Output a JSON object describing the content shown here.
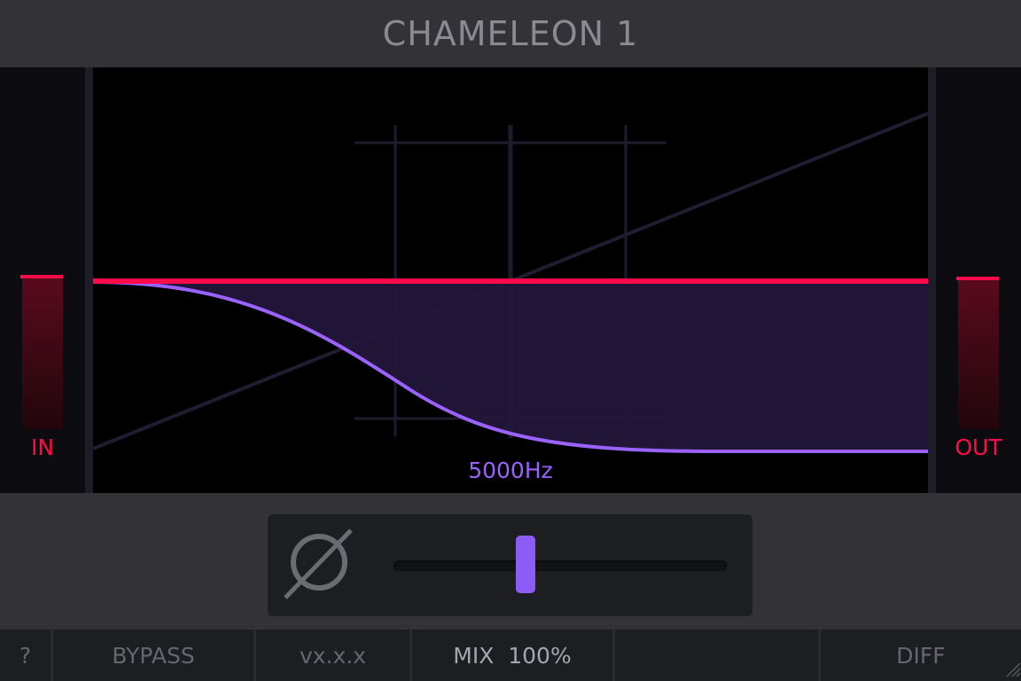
{
  "header": {
    "title": "CHAMELEON 1"
  },
  "meters": {
    "input": {
      "label": "IN",
      "level": 0.62
    },
    "output": {
      "label": "OUT",
      "level": 0.62
    }
  },
  "graph": {
    "frequency_readout": "5000Hz",
    "colors": {
      "flat_curve": "#ff0a4a",
      "filter_curve": "#9a62ff",
      "fill": "#23163d"
    }
  },
  "controls": {
    "phase_icon": "phase-invert-icon",
    "slider_value": 0.4
  },
  "footer": {
    "help_label": "?",
    "bypass_label": "BYPASS",
    "version_label": "vx.x.x",
    "mix_label": "MIX  100%",
    "empty_label": "",
    "diff_label": "DIFF"
  },
  "colors": {
    "accent": "#ff0a4a",
    "purple": "#8b5cf6",
    "background": "#333337"
  }
}
